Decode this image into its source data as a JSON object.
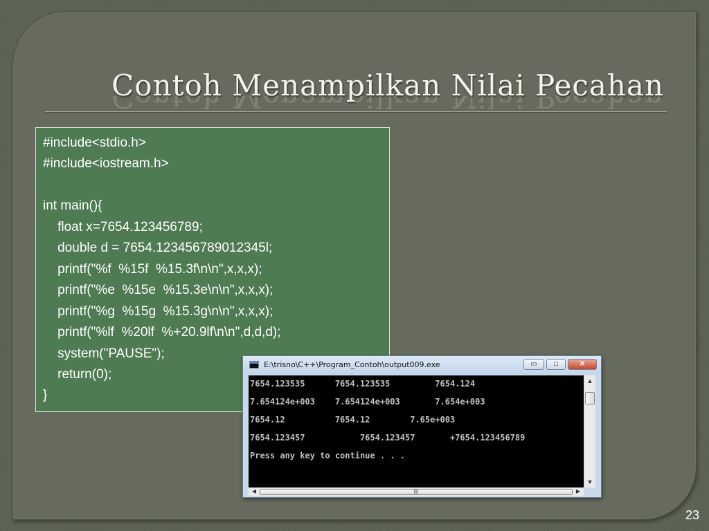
{
  "slide": {
    "title": "Contoh Menampilkan Nilai Pecahan",
    "page_number": "23"
  },
  "code": {
    "lines": [
      "#include<stdio.h>",
      "#include<iostream.h>",
      "",
      "int main(){",
      "    float x=7654.123456789;",
      "    double d = 7654.123456789012345l;",
      "    printf(\"%f  %15f  %15.3f\\n\\n\",x,x,x);",
      "    printf(\"%e  %15e  %15.3e\\n\\n\",x,x,x);",
      "    printf(\"%g  %15g  %15.3g\\n\\n\",x,x,x);",
      "    printf(\"%lf  %20lf  %+20.9lf\\n\\n\",d,d,d);",
      "    system(\"PAUSE\");",
      "    return(0);",
      "}"
    ]
  },
  "console": {
    "window_title": "E:\\trisno\\C++\\Program_Contoh\\output009.exe",
    "buttons": {
      "minimize": "▭",
      "maximize": "□",
      "close": "✕"
    },
    "output": [
      "7654.123535      7654.123535         7654.124",
      "7.654124e+003    7.654124e+003       7.654e+003",
      "7654.12          7654.12        7.65e+003",
      "7654.123457           7654.123457       +7654.123456789",
      "Press any key to continue . . ."
    ],
    "scrollbar": {
      "up": "▲",
      "down": "▼",
      "left": "◀",
      "right": "▶",
      "grip": "III"
    }
  },
  "colors": {
    "background": "#5d6353",
    "code_box": "#4e7b52",
    "console_bg": "#000000"
  }
}
